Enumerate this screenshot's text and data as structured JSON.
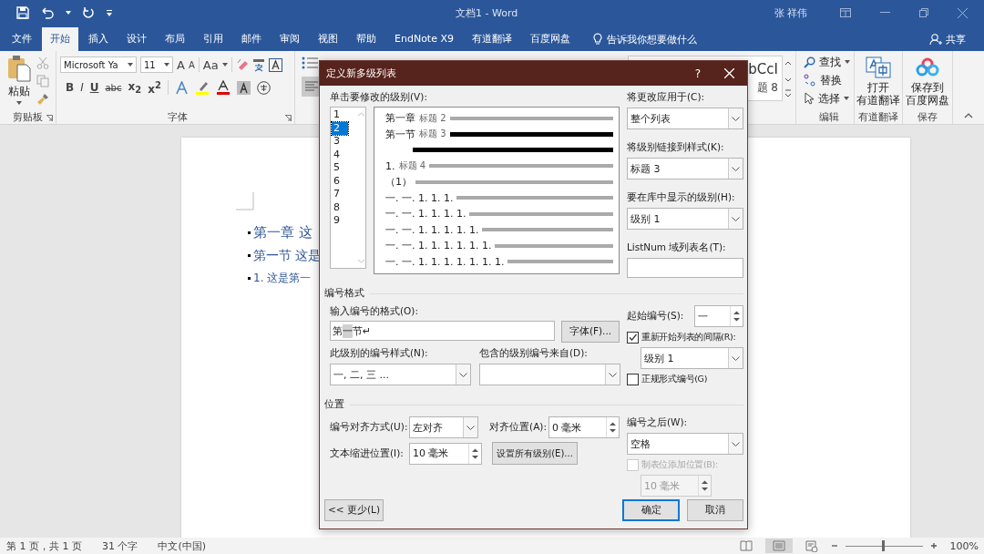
{
  "window": {
    "title": "文档1  -  Word",
    "user": "张 祥伟"
  },
  "tabs": [
    {
      "label": "文件",
      "selected": false
    },
    {
      "label": "开始",
      "selected": true
    },
    {
      "label": "插入",
      "selected": false
    },
    {
      "label": "设计",
      "selected": false
    },
    {
      "label": "布局",
      "selected": false
    },
    {
      "label": "引用",
      "selected": false
    },
    {
      "label": "邮件",
      "selected": false
    },
    {
      "label": "审阅",
      "selected": false
    },
    {
      "label": "视图",
      "selected": false
    },
    {
      "label": "帮助",
      "selected": false
    },
    {
      "label": "EndNote X9",
      "selected": false
    },
    {
      "label": "有道翻译",
      "selected": false
    },
    {
      "label": "百度网盘",
      "selected": false
    }
  ],
  "tell_me": "告诉我你想要做什么",
  "share": "共享",
  "ribbon": {
    "clipboard": {
      "paste": "粘贴",
      "label": "剪贴板"
    },
    "font": {
      "name": "Microsoft Ya",
      "size": "11",
      "grow": "A",
      "shrink": "A",
      "case": "Aa",
      "styles": [
        "B",
        "I",
        "U",
        "abc",
        "x$_{2}$",
        "x$^{2}$"
      ],
      "label": "字体"
    },
    "styles": {
      "preview": "bCcI",
      "name": "题 8"
    },
    "editing": {
      "items": [
        "查找",
        "替换",
        "选择"
      ],
      "label": "编辑"
    },
    "youdao": {
      "lines": [
        "打开",
        "有道翻译"
      ],
      "label": "有道翻译"
    },
    "baidu": {
      "lines": [
        "保存到",
        "百度网盘"
      ],
      "label": "保存"
    }
  },
  "document": {
    "lines": [
      {
        "text": "第一章 这",
        "kind": "chapter"
      },
      {
        "text": "第一节 这是",
        "kind": "section"
      },
      {
        "text": "1. 这是第一",
        "kind": "item"
      }
    ]
  },
  "dialog": {
    "title": "定义新多级列表",
    "help": "?",
    "levels_label": "单击要修改的级别(V):",
    "levels": [
      {
        "label": "1",
        "selected": false
      },
      {
        "label": "2",
        "selected": true
      },
      {
        "label": "3",
        "selected": false
      },
      {
        "label": "4",
        "selected": false
      },
      {
        "label": "5",
        "selected": false
      },
      {
        "label": "6",
        "selected": false
      },
      {
        "label": "7",
        "selected": false
      },
      {
        "label": "8",
        "selected": false
      },
      {
        "label": "9",
        "selected": false
      }
    ],
    "preview": [
      {
        "number": "第一章",
        "style": "标题 2",
        "emphasis": false
      },
      {
        "number": "第一节",
        "style": "标题 3",
        "emphasis": true
      },
      {
        "emphasis": true
      },
      {
        "number": "1.",
        "style": "标题 4",
        "emphasis": false
      },
      {
        "number": "（1）",
        "emphasis": false
      },
      {
        "number": "一. 一. 1. 1. 1.",
        "emphasis": false
      },
      {
        "number": "一. 一. 1. 1. 1. 1.",
        "emphasis": false
      },
      {
        "number": "一. 一. 1. 1. 1. 1. 1.",
        "emphasis": false
      },
      {
        "number": "一. 一. 1. 1. 1. 1. 1. 1.",
        "emphasis": false
      },
      {
        "number": "一. 一. 1. 1. 1. 1. 1. 1. 1.",
        "emphasis": false
      }
    ],
    "apply_to": {
      "label": "将更改应用于(C):",
      "value": "整个列表"
    },
    "link_style": {
      "label": "将级别链接到样式(K):",
      "value": "标题 3"
    },
    "gallery_level": {
      "label": "要在库中显示的级别(H):",
      "value": "级别 1"
    },
    "listnum": {
      "label": "ListNum 域列表名(T):"
    },
    "format_section": "编号格式",
    "format_input": {
      "label": "输入编号的格式(O):",
      "parts": [
        {
          "text": "第",
          "field": false
        },
        {
          "text": "一",
          "field": true
        },
        {
          "text": "节↵",
          "field": false
        }
      ]
    },
    "font_button": "字体(F)...",
    "start_at": {
      "label": "起始编号(S):",
      "value": "一"
    },
    "restart": {
      "label": "重新开始列表的间隔(R):",
      "checked": true,
      "value": "级别 1"
    },
    "number_style": {
      "label": "此级别的编号样式(N):",
      "value": "一, 二, 三 ..."
    },
    "include_from": {
      "label": "包含的级别编号来自(D):"
    },
    "legal": {
      "label": "正规形式编号(G)",
      "checked": false
    },
    "position_section": "位置",
    "alignment": {
      "label": "编号对齐方式(U):",
      "value": "左对齐"
    },
    "aligned_at": {
      "label": "对齐位置(A):",
      "value": "0 毫米"
    },
    "indent": {
      "label": "文本缩进位置(I):",
      "value": "10 毫米"
    },
    "set_all": "设置所有级别(E)...",
    "follow": {
      "label": "编号之后(W):",
      "value": "空格"
    },
    "tab_stop": {
      "label": "制表位添加位置(B):",
      "checked": false,
      "disabled": true,
      "value": "10 毫米"
    },
    "less": "<< 更少(L)",
    "ok": "确定",
    "cancel": "取消"
  },
  "status_bar": {
    "page": "第 1 页，共 1 页",
    "words": "31 个字",
    "language": "中文(中国)",
    "zoom": "100%",
    "zoom_slider": {
      "level": 0.5
    }
  }
}
